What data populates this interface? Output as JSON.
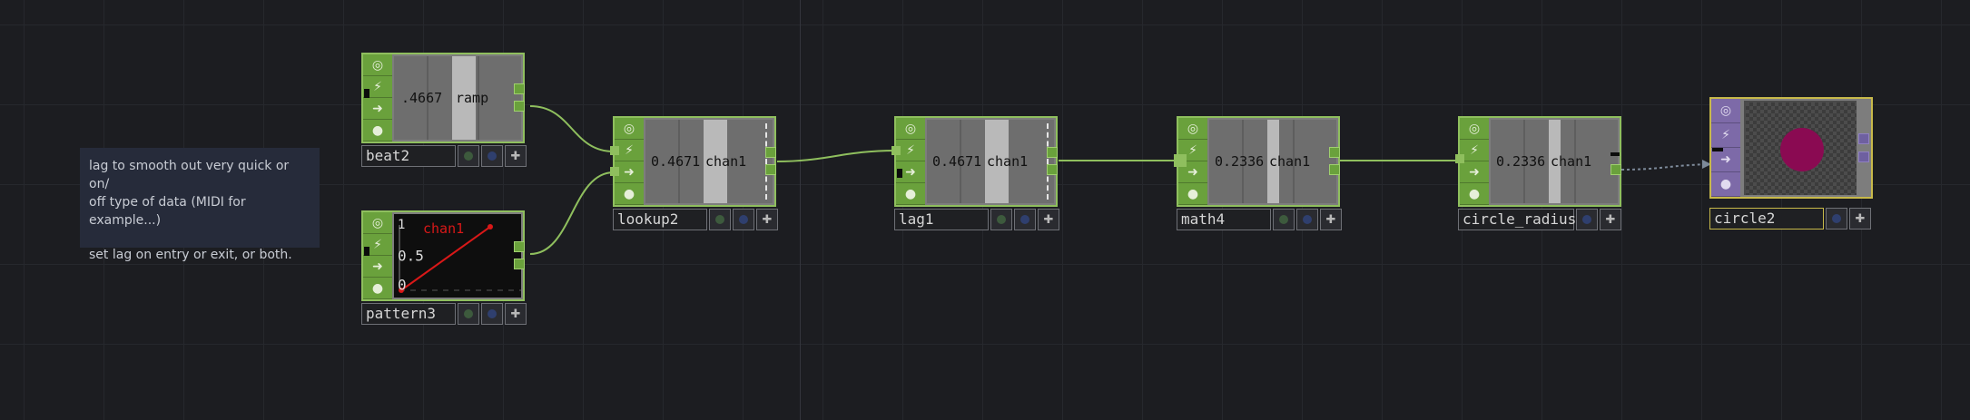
{
  "note": {
    "line1": "lag to smooth out very quick or on/",
    "line2": "off type of data (MIDI for example...)",
    "line3": "set lag on entry or exit, or both."
  },
  "nodes": {
    "beat2": {
      "name": "beat2",
      "value": ".4667",
      "channel": "ramp"
    },
    "pattern3": {
      "name": "pattern3",
      "channel": "chan1",
      "tick_top": "1",
      "tick_mid": "0.5",
      "tick_bottom": "0"
    },
    "lookup2": {
      "name": "lookup2",
      "value": "0.4671",
      "channel": "chan1"
    },
    "lag1": {
      "name": "lag1",
      "value": "0.4671",
      "channel": "chan1"
    },
    "math4": {
      "name": "math4",
      "value": "0.2336",
      "channel": "chan1"
    },
    "circle_radius": {
      "name": "circle_radius",
      "value": "0.2336",
      "channel": "chan1"
    },
    "circle2": {
      "name": "circle2"
    }
  },
  "colors": {
    "chop_flag": "#6aa13c",
    "top_flag": "#7d6aa8",
    "wire": "#8fbf5e",
    "circle_fill": "#8a0a52",
    "pattern_line": "#d81818"
  },
  "icons": [
    "viewer-icon",
    "bypass-icon",
    "display-icon",
    "lock-icon",
    "plus-icon"
  ]
}
